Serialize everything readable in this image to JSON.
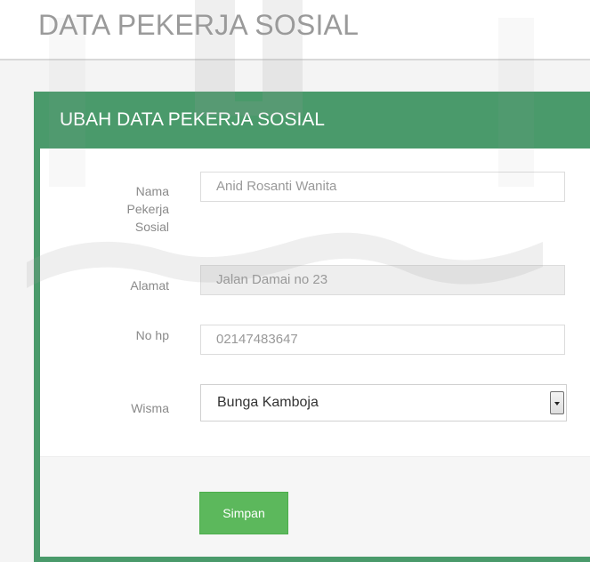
{
  "page": {
    "title": "DATA PEKERJA SOSIAL"
  },
  "panel": {
    "title": "UBAH DATA PEKERJA SOSIAL"
  },
  "form": {
    "nama": {
      "label": "Nama\nPekerja\nSosial",
      "value": "Anid Rosanti  Wanita"
    },
    "alamat": {
      "label": "Alamat",
      "value": "Jalan Damai no 23"
    },
    "nohp": {
      "label": "No hp",
      "value": "02147483647"
    },
    "wisma": {
      "label": "Wisma",
      "value": "Bunga Kamboja"
    },
    "submit_label": "Simpan"
  },
  "colors": {
    "panel_green": "#4a9a6b",
    "button_green": "#5cb85c",
    "title_gray": "#9a9a9a"
  },
  "icons": {
    "select_arrow": "chevron-down-icon"
  }
}
